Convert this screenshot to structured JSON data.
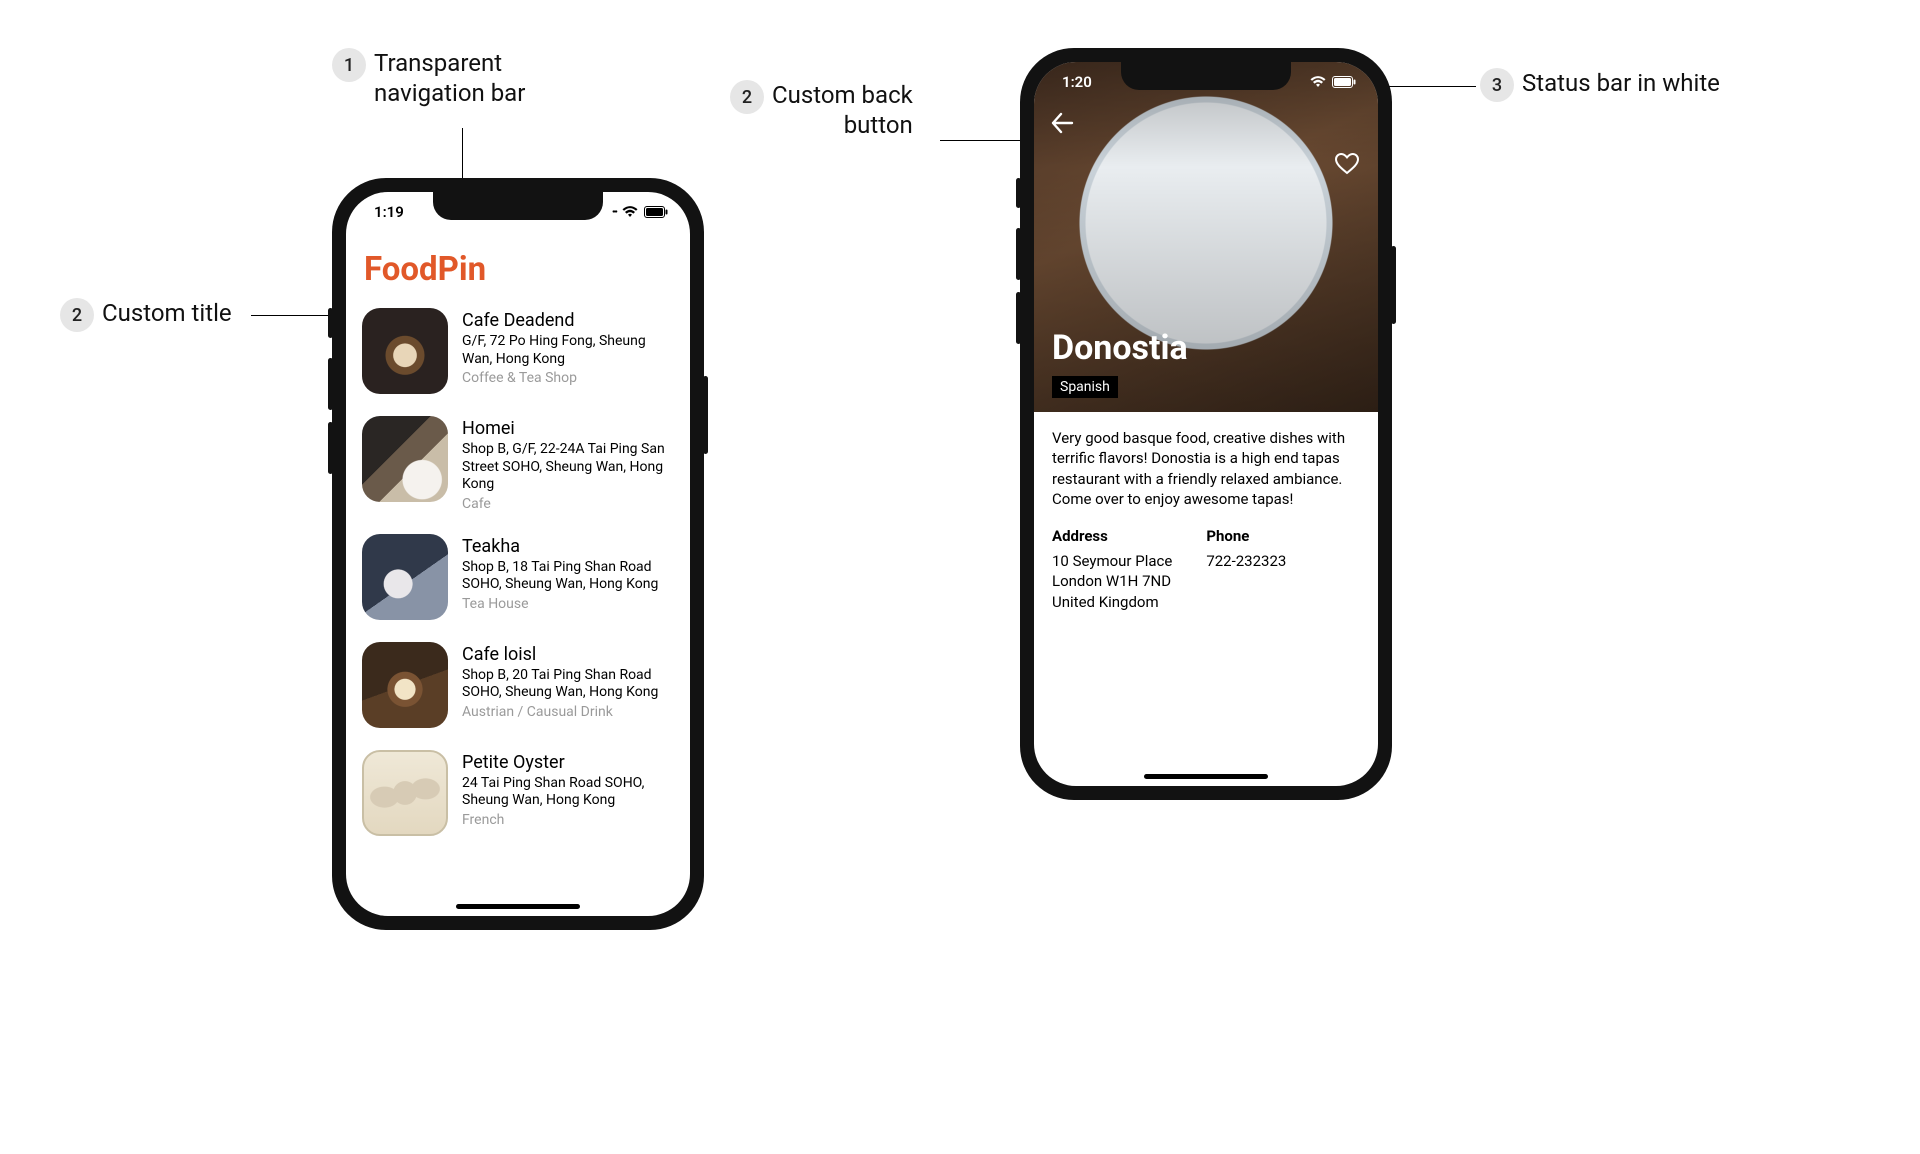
{
  "accent_color": "#e15829",
  "callouts": {
    "c1": {
      "num": "1",
      "text": "Transparent\nnavigation bar"
    },
    "c2_left": {
      "num": "2",
      "text": "Custom title"
    },
    "c2_right": {
      "num": "2",
      "text": "Custom back\nbutton"
    },
    "c3": {
      "num": "3",
      "text": "Status bar in white"
    }
  },
  "left_phone": {
    "status_time": "1:19",
    "app_title": "FoodPin",
    "rows": [
      {
        "name": "Cafe Deadend",
        "address": "G/F, 72 Po Hing Fong, Sheung Wan, Hong Kong",
        "type": "Coffee & Tea Shop"
      },
      {
        "name": "Homei",
        "address": "Shop B, G/F, 22-24A Tai Ping San Street SOHO, Sheung Wan, Hong Kong",
        "type": "Cafe"
      },
      {
        "name": "Teakha",
        "address": "Shop B, 18 Tai Ping Shan Road SOHO, Sheung Wan, Hong Kong",
        "type": "Tea House"
      },
      {
        "name": "Cafe loisl",
        "address": "Shop B, 20 Tai Ping Shan Road SOHO, Sheung Wan, Hong Kong",
        "type": "Austrian / Causual Drink"
      },
      {
        "name": "Petite Oyster",
        "address": "24 Tai Ping Shan Road SOHO, Sheung Wan, Hong Kong",
        "type": "French"
      }
    ]
  },
  "right_phone": {
    "status_time": "1:20",
    "title": "Donostia",
    "category": "Spanish",
    "description": "Very good basque food, creative dishes with terrific flavors! Donostia is a high end tapas restaurant with a friendly relaxed ambiance. Come over to enjoy awesome tapas!",
    "address_label": "Address",
    "address_value": "10 Seymour Place\nLondon W1H 7ND\nUnited Kingdom",
    "phone_label": "Phone",
    "phone_value": "722-232323"
  }
}
